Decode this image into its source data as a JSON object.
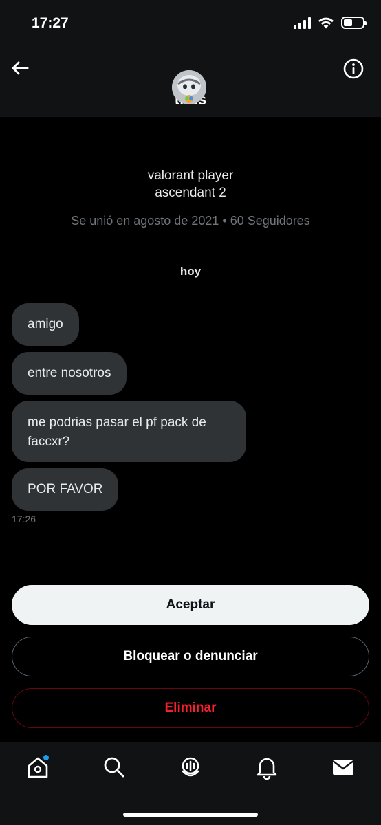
{
  "status_bar": {
    "time": "17:27",
    "signal_icon": "cellular-signal-icon",
    "wifi_icon": "wifi-icon",
    "battery_icon": "battery-icon",
    "battery_level": 0.45
  },
  "header": {
    "back_icon": "arrow-left-icon",
    "info_icon": "info-circle-icon",
    "username": "tr   xs"
  },
  "profile": {
    "bio_line1": "valorant player",
    "bio_line2": "ascendant 2",
    "joined": "Se unió en agosto de 2021",
    "separator": "•",
    "followers": "60 Seguidores"
  },
  "conversation": {
    "date_label": "hoy",
    "messages": [
      {
        "text": "amigo"
      },
      {
        "text": "entre nosotros"
      },
      {
        "text": "me podrias pasar el pf pack de faccxr?"
      },
      {
        "text": "POR FAVOR"
      }
    ],
    "last_time": "17:26"
  },
  "actions": {
    "accept": "Aceptar",
    "block_report": "Bloquear o denunciar",
    "delete": "Eliminar"
  },
  "tabbar": {
    "items": [
      "home-icon",
      "search-icon",
      "spaces-icon",
      "bell-icon",
      "mail-icon"
    ],
    "notification_dot_color": "#1d9bf0"
  },
  "colors": {
    "background": "#000000",
    "bubble": "#2f3336",
    "danger": "#f4212e",
    "accent": "#1d9bf0"
  }
}
